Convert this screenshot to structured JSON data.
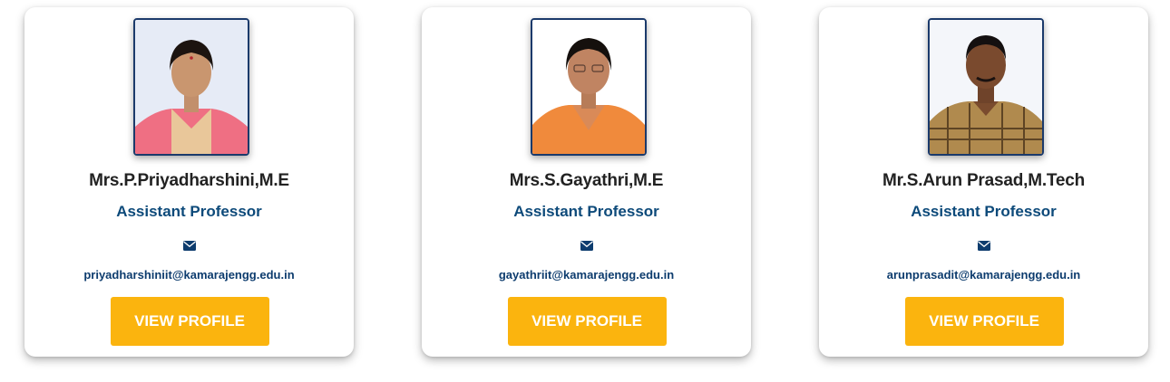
{
  "faculty": [
    {
      "name": "Mrs.P.Priyadharshini,M.E",
      "designation": "Assistant Professor",
      "email": "priyadharshiniit@kamarajengg.edu.in",
      "button_label": "VIEW PROFILE",
      "photo_icon": "portrait-photo-woman"
    },
    {
      "name": "Mrs.S.Gayathri,M.E",
      "designation": "Assistant Professor",
      "email": "gayathriit@kamarajengg.edu.in",
      "button_label": "VIEW PROFILE",
      "photo_icon": "portrait-photo-woman"
    },
    {
      "name": "Mr.S.Arun Prasad,M.Tech",
      "designation": "Assistant Professor",
      "email": "arunprasadit@kamarajengg.edu.in",
      "button_label": "VIEW PROFILE",
      "photo_icon": "portrait-photo-man"
    }
  ],
  "colors": {
    "accent_button": "#fbb40e",
    "designation_text": "#0d4a7a",
    "email_text": "#0d3c6e",
    "photo_border": "#1b3a6b"
  },
  "icons": {
    "email": "envelope-icon"
  }
}
